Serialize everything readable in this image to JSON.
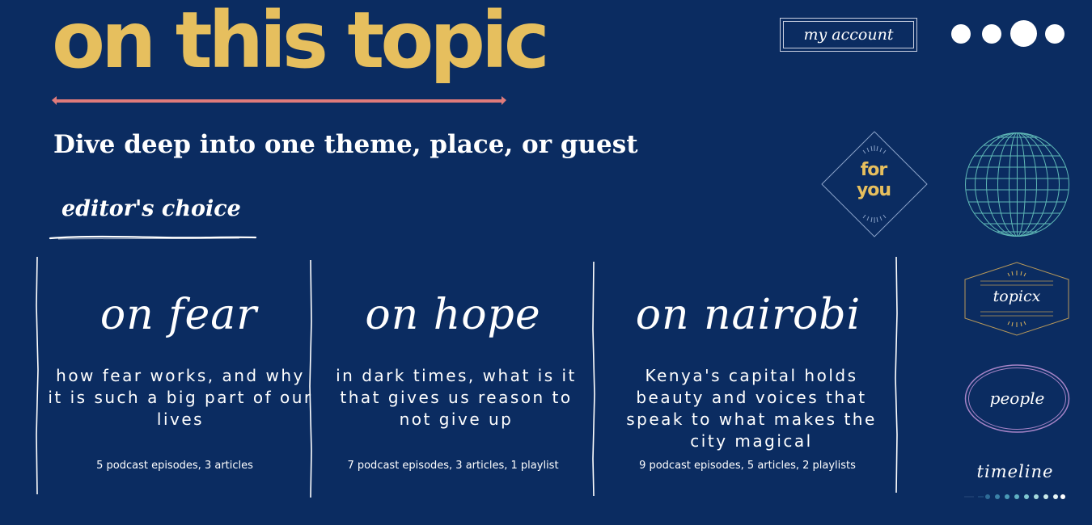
{
  "header": {
    "title": "on this topic",
    "subtitle": "Dive deep into one theme, place, or guest",
    "section_label": "editor's choice"
  },
  "account": {
    "label": "my account"
  },
  "page_dots": {
    "count": 4,
    "active_index": 2
  },
  "colors": {
    "background": "#0b2c61",
    "title_yellow": "#e6bf5e",
    "underline_pink": "#e07b7b",
    "globe_teal": "#5fb8b6",
    "people_purple": "#a684c7",
    "topicx_gold": "#b8995a"
  },
  "topics": [
    {
      "title": "on fear",
      "description": "how fear works, and why it is such a big part of our lives",
      "meta": "5 podcast episodes, 3 articles"
    },
    {
      "title": "on hope",
      "description": "in dark times, what is it that gives us reason to not give up",
      "meta": "7 podcast episodes, 3 articles, 1 playlist"
    },
    {
      "title": "on nairobi",
      "description": "Kenya's capital holds beauty and voices that speak to what makes the city magical",
      "meta": "9 podcast episodes, 5 articles, 2 playlists"
    }
  ],
  "nav": {
    "for_you": "for you",
    "topicx": "topicx",
    "people": "people",
    "timeline": "timeline"
  }
}
